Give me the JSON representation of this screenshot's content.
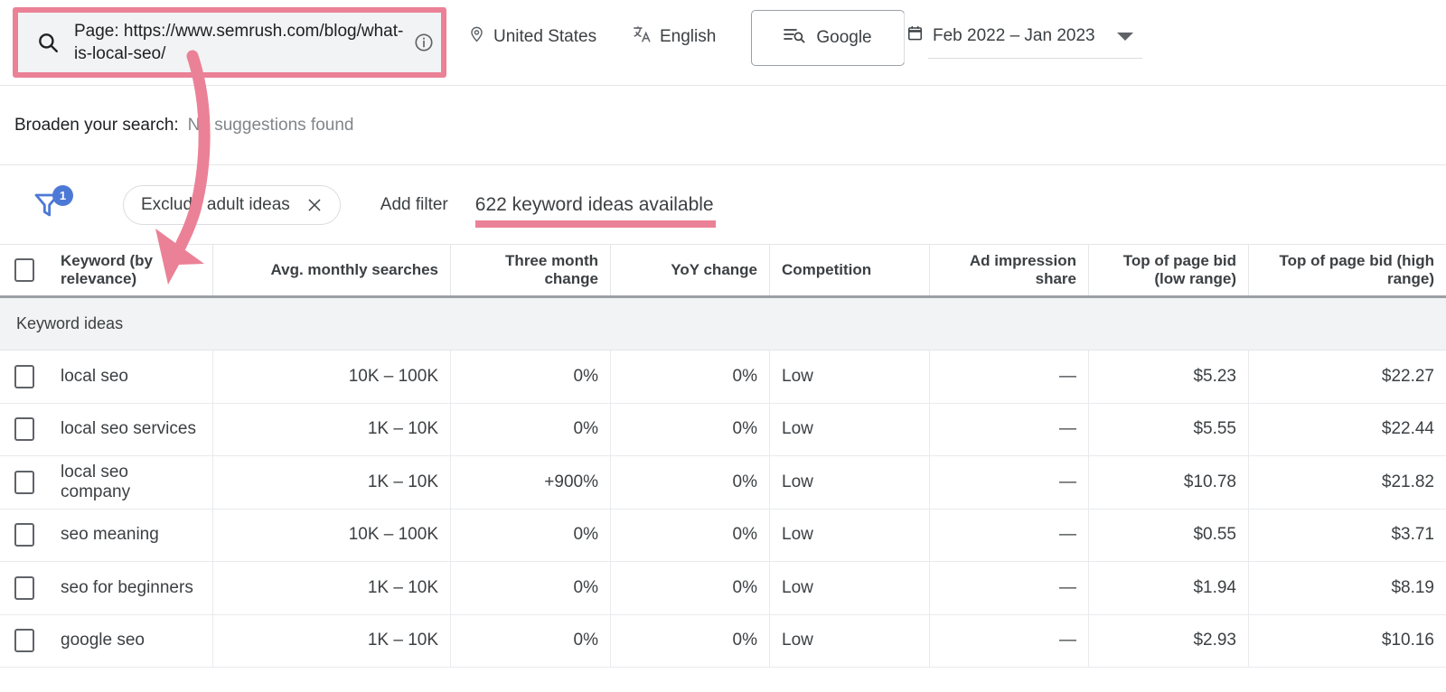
{
  "colors": {
    "annotation_pink": "#eb8196",
    "badge_blue": "#4d79d6",
    "text_primary": "#3c4043",
    "text_muted": "#80868b",
    "row_group_bg": "#f1f3f4"
  },
  "toolbar": {
    "search_value": "Page: https://www.semrush.com/blog/what-is-local-seo/",
    "search_icon": "search-icon",
    "info_icon": "info-icon",
    "location": "United States",
    "location_icon": "location-pin-icon",
    "language": "English",
    "language_icon": "translate-icon",
    "network_button": "Google",
    "network_icon": "manage-search-icon",
    "date_range": "Feb 2022 – Jan 2023",
    "calendar_icon": "calendar-icon",
    "caret_icon": "chevron-down-icon"
  },
  "broaden": {
    "label": "Broaden your search:",
    "value": "No suggestions found"
  },
  "filters": {
    "funnel_icon": "filter-funnel-icon",
    "badge_count": "1",
    "chip_label": "Exclude adult ideas",
    "chip_close_icon": "close-icon",
    "add_filter": "Add filter",
    "ideas_count": "622 keyword ideas available"
  },
  "table": {
    "group_label": "Keyword ideas",
    "headers": {
      "keyword": "Keyword (by relevance)",
      "avg_monthly_searches": "Avg. monthly searches",
      "three_month_change": "Three month change",
      "yoy_change": "YoY change",
      "competition": "Competition",
      "ad_impression_share": "Ad impression share",
      "top_bid_low": "Top of page bid (low range)",
      "top_bid_high": "Top of page bid (high range)"
    },
    "rows": [
      {
        "keyword": "local seo",
        "avg_monthly_searches": "10K – 100K",
        "three_month_change": "0%",
        "yoy_change": "0%",
        "competition": "Low",
        "ad_impression_share": "—",
        "top_bid_low": "$5.23",
        "top_bid_high": "$22.27"
      },
      {
        "keyword": "local seo services",
        "avg_monthly_searches": "1K – 10K",
        "three_month_change": "0%",
        "yoy_change": "0%",
        "competition": "Low",
        "ad_impression_share": "—",
        "top_bid_low": "$5.55",
        "top_bid_high": "$22.44"
      },
      {
        "keyword": "local seo company",
        "avg_monthly_searches": "1K – 10K",
        "three_month_change": "+900%",
        "yoy_change": "0%",
        "competition": "Low",
        "ad_impression_share": "—",
        "top_bid_low": "$10.78",
        "top_bid_high": "$21.82"
      },
      {
        "keyword": "seo meaning",
        "avg_monthly_searches": "10K – 100K",
        "three_month_change": "0%",
        "yoy_change": "0%",
        "competition": "Low",
        "ad_impression_share": "—",
        "top_bid_low": "$0.55",
        "top_bid_high": "$3.71"
      },
      {
        "keyword": "seo for beginners",
        "avg_monthly_searches": "1K – 10K",
        "three_month_change": "0%",
        "yoy_change": "0%",
        "competition": "Low",
        "ad_impression_share": "—",
        "top_bid_low": "$1.94",
        "top_bid_high": "$8.19"
      },
      {
        "keyword": "google seo",
        "avg_monthly_searches": "1K – 10K",
        "three_month_change": "0%",
        "yoy_change": "0%",
        "competition": "Low",
        "ad_impression_share": "—",
        "top_bid_low": "$2.93",
        "top_bid_high": "$10.16"
      }
    ]
  },
  "annotations": {
    "arrow_icon": "curved-arrow-annotation",
    "search_highlight_icon": "highlight-box-annotation",
    "count_underline_icon": "underline-annotation"
  }
}
